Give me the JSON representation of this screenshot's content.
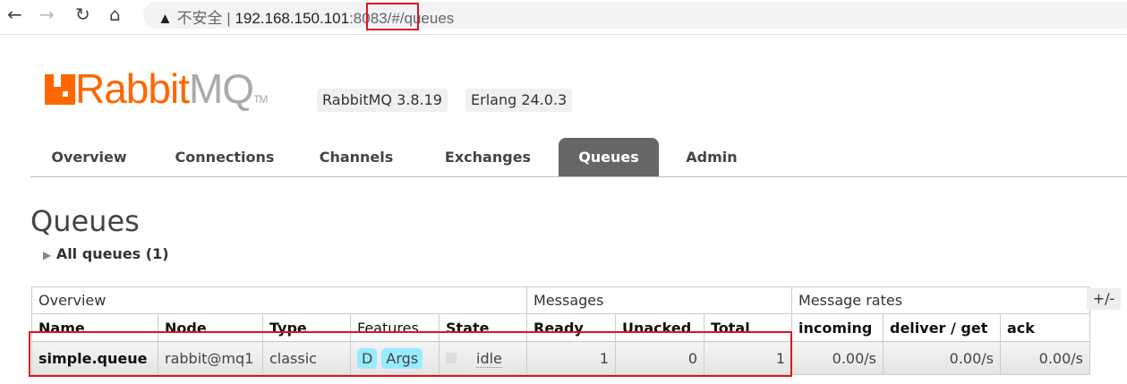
{
  "browser": {
    "security_label": "不安全",
    "url_host": "192.168.150.101",
    "url_port": ":8083",
    "url_path": "/#/queues"
  },
  "header": {
    "logo_rabbit": "Rabbit",
    "logo_mq": "MQ",
    "logo_tm": "TM",
    "version": "RabbitMQ 3.8.19",
    "erlang": "Erlang 24.0.3"
  },
  "tabs": [
    "Overview",
    "Connections",
    "Channels",
    "Exchanges",
    "Queues",
    "Admin"
  ],
  "page_title": "Queues",
  "section": "All queues (1)",
  "table": {
    "groups": [
      "Overview",
      "Messages",
      "Message rates"
    ],
    "columns": [
      "Name",
      "Node",
      "Type",
      "Features",
      "State",
      "Ready",
      "Unacked",
      "Total",
      "incoming",
      "deliver / get",
      "ack"
    ],
    "rows": [
      {
        "name": "simple.queue",
        "node": "rabbit@mq1",
        "type": "classic",
        "features": [
          "D",
          "Args"
        ],
        "state": "idle",
        "ready": "1",
        "unacked": "0",
        "total": "1",
        "incoming": "0.00/s",
        "deliver_get": "0.00/s",
        "ack": "0.00/s"
      }
    ]
  },
  "toggle_columns": "+/-"
}
